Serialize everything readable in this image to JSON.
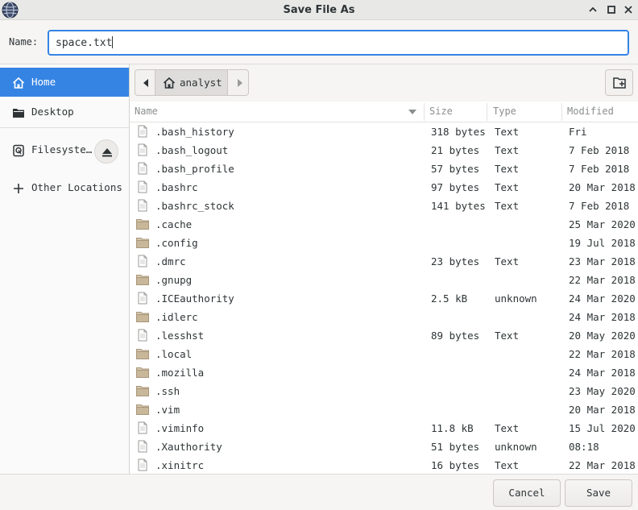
{
  "window": {
    "title": "Save File As"
  },
  "name_field": {
    "label": "Name:",
    "value": "space.txt"
  },
  "sidebar": {
    "items": [
      {
        "label": "Home",
        "icon": "home-icon",
        "active": true
      },
      {
        "label": "Desktop",
        "icon": "folder-icon",
        "active": false
      },
      {
        "label": "Filesyste…",
        "icon": "drive-icon",
        "active": false
      },
      {
        "label": "Other Locations",
        "icon": "plus-icon",
        "active": false
      }
    ]
  },
  "pathbar": {
    "current": "analyst"
  },
  "columns": {
    "name": "Name",
    "size": "Size",
    "type": "Type",
    "modified": "Modified"
  },
  "files": [
    {
      "name": ".bash_history",
      "kind": "file",
      "size": "318 bytes",
      "type": "Text",
      "modified": "Fri"
    },
    {
      "name": ".bash_logout",
      "kind": "file",
      "size": "21 bytes",
      "type": "Text",
      "modified": "7 Feb 2018"
    },
    {
      "name": ".bash_profile",
      "kind": "file",
      "size": "57 bytes",
      "type": "Text",
      "modified": "7 Feb 2018"
    },
    {
      "name": ".bashrc",
      "kind": "file",
      "size": "97 bytes",
      "type": "Text",
      "modified": "20 Mar 2018"
    },
    {
      "name": ".bashrc_stock",
      "kind": "file",
      "size": "141 bytes",
      "type": "Text",
      "modified": "7 Feb 2018"
    },
    {
      "name": ".cache",
      "kind": "folder",
      "size": "",
      "type": "",
      "modified": "25 Mar 2020"
    },
    {
      "name": ".config",
      "kind": "folder",
      "size": "",
      "type": "",
      "modified": "19 Jul 2018"
    },
    {
      "name": ".dmrc",
      "kind": "file",
      "size": "23 bytes",
      "type": "Text",
      "modified": "23 Mar 2018"
    },
    {
      "name": ".gnupg",
      "kind": "folder",
      "size": "",
      "type": "",
      "modified": "22 Mar 2018"
    },
    {
      "name": ".ICEauthority",
      "kind": "file",
      "size": "2.5 kB",
      "type": "unknown",
      "modified": "24 Mar 2020"
    },
    {
      "name": ".idlerc",
      "kind": "folder",
      "size": "",
      "type": "",
      "modified": "24 Mar 2018"
    },
    {
      "name": ".lesshst",
      "kind": "file",
      "size": "89 bytes",
      "type": "Text",
      "modified": "20 May 2020"
    },
    {
      "name": ".local",
      "kind": "folder",
      "size": "",
      "type": "",
      "modified": "22 Mar 2018"
    },
    {
      "name": ".mozilla",
      "kind": "folder",
      "size": "",
      "type": "",
      "modified": "24 Mar 2018"
    },
    {
      "name": ".ssh",
      "kind": "folder",
      "size": "",
      "type": "",
      "modified": "23 May 2020"
    },
    {
      "name": ".vim",
      "kind": "folder",
      "size": "",
      "type": "",
      "modified": "20 Mar 2018"
    },
    {
      "name": ".viminfo",
      "kind": "file",
      "size": "11.8 kB",
      "type": "Text",
      "modified": "15 Jul 2020"
    },
    {
      "name": ".Xauthority",
      "kind": "file",
      "size": "51 bytes",
      "type": "unknown",
      "modified": "08:18"
    },
    {
      "name": ".xinitrc",
      "kind": "file",
      "size": "16 bytes",
      "type": "Text",
      "modified": "22 Mar 2018"
    }
  ],
  "buttons": {
    "cancel": "Cancel",
    "save": "Save"
  },
  "colors": {
    "accent": "#3584e4",
    "folder": "#c9b79a",
    "window_bg": "#f6f5f4"
  }
}
